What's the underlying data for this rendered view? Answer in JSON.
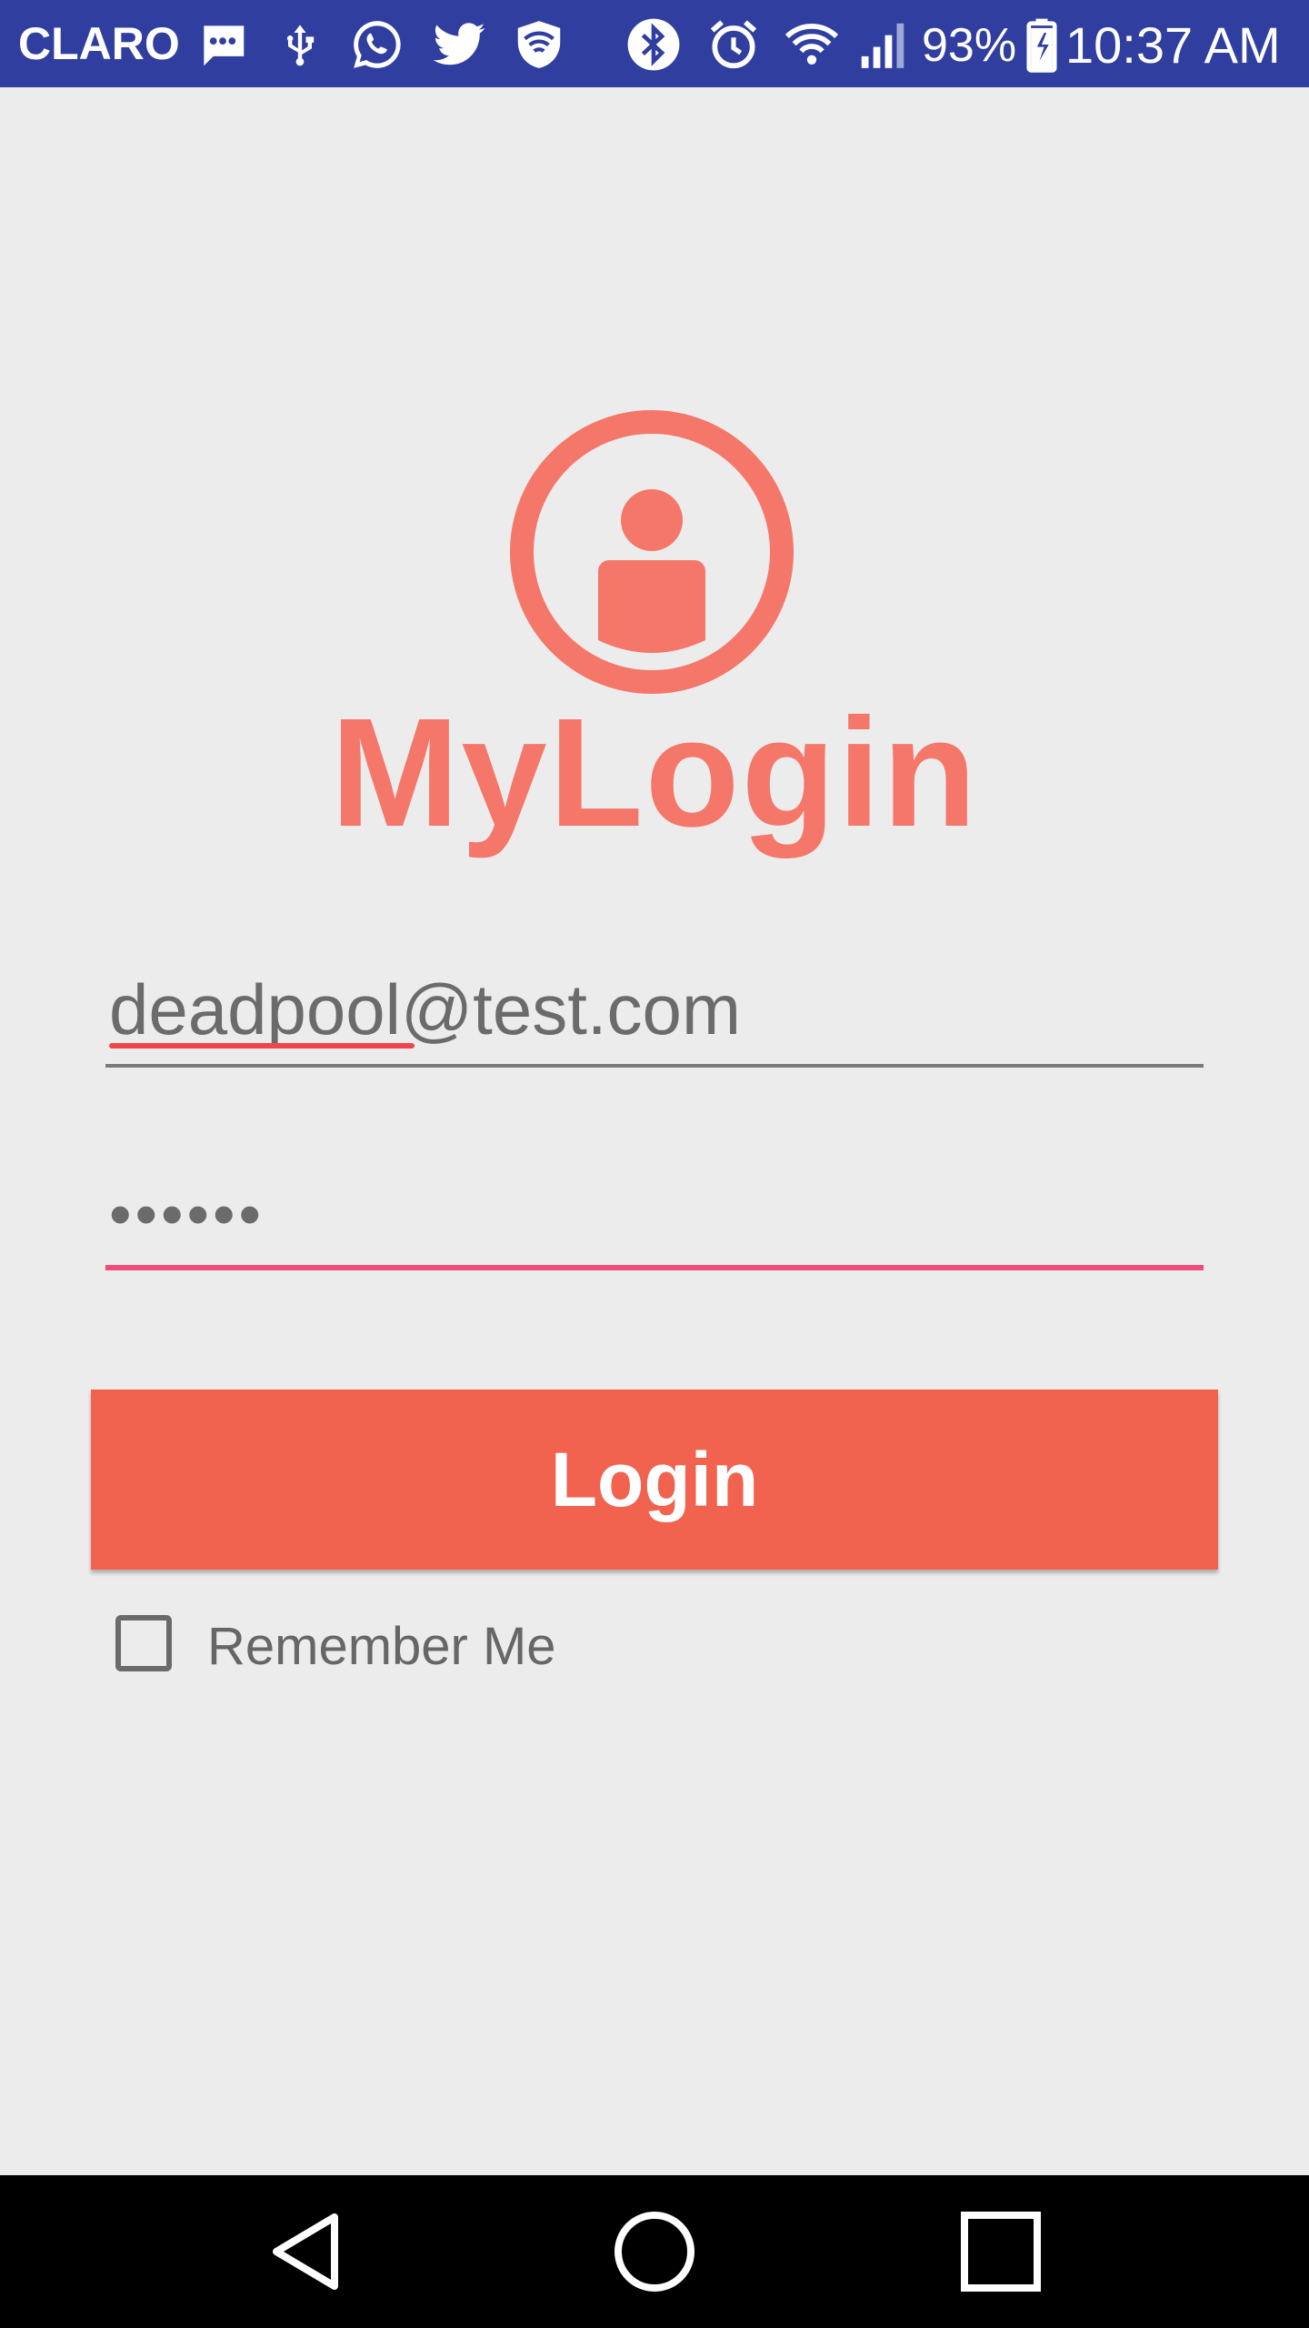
{
  "status_bar": {
    "carrier": "CLARO",
    "battery": "93%",
    "time": "10:37 AM",
    "icons": [
      "message-icon",
      "usb-icon",
      "whatsapp-icon",
      "twitter-icon",
      "shield-wifi-icon",
      "bluetooth-icon",
      "alarm-icon",
      "wifi-icon",
      "signal-icon",
      "battery-charging-icon"
    ],
    "background": "#303f9f"
  },
  "app": {
    "logo_icon": "user-circle-icon",
    "title": "MyLogin",
    "accent_color": "#f4776a"
  },
  "form": {
    "email_value": "deadpool@test.com",
    "password_value": "••••••",
    "login_label": "Login",
    "login_color": "#f1624f",
    "remember_label": "Remember Me",
    "remember_checked": false
  },
  "nav_bar": {
    "buttons": [
      "back-icon",
      "home-icon",
      "recents-icon"
    ]
  }
}
